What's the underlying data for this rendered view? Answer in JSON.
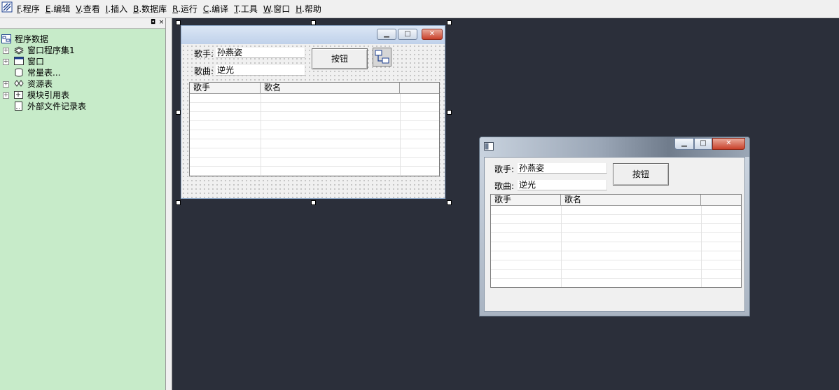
{
  "menu": [
    {
      "key": "F",
      "label": ".程序"
    },
    {
      "key": "E",
      "label": ".编辑"
    },
    {
      "key": "V",
      "label": ".查看"
    },
    {
      "key": "I",
      "label": ".插入"
    },
    {
      "key": "B",
      "label": ".数据库"
    },
    {
      "key": "R",
      "label": ".运行"
    },
    {
      "key": "C",
      "label": ".编译"
    },
    {
      "key": "T",
      "label": ".工具"
    },
    {
      "key": "W",
      "label": ".窗口"
    },
    {
      "key": "H",
      "label": ".帮助"
    }
  ],
  "panel": {
    "pin_glyph": "◘",
    "close_glyph": "×"
  },
  "tree": {
    "root": "程序数据",
    "items": [
      {
        "label": "窗口程序集1",
        "toggle": "+",
        "icon": "layers-icon"
      },
      {
        "label": "窗口",
        "toggle": "+",
        "icon": "window-icon"
      },
      {
        "label": "常量表...",
        "toggle": "",
        "icon": "cylinder-icon"
      },
      {
        "label": "资源表",
        "toggle": "+",
        "icon": "resource-icon"
      },
      {
        "label": "模块引用表",
        "toggle": "+",
        "icon": "module-icon"
      },
      {
        "label": "外部文件记录表",
        "toggle": "",
        "icon": "file-icon"
      }
    ]
  },
  "design_form": {
    "singer_label": "歌手:",
    "singer_value": "孙燕姿",
    "song_label": "歌曲:",
    "song_value": "逆光",
    "button_label": "按钮",
    "columns": [
      "歌手",
      "歌名",
      ""
    ]
  },
  "preview_form": {
    "singer_label": "歌手:",
    "singer_value": "孙燕姿",
    "song_label": "歌曲:",
    "song_value": "逆光",
    "button_label": "按钮",
    "columns": [
      "歌手",
      "歌名",
      ""
    ]
  },
  "caption": {
    "minimize": "▁",
    "maximize": "□",
    "close": "✕"
  }
}
